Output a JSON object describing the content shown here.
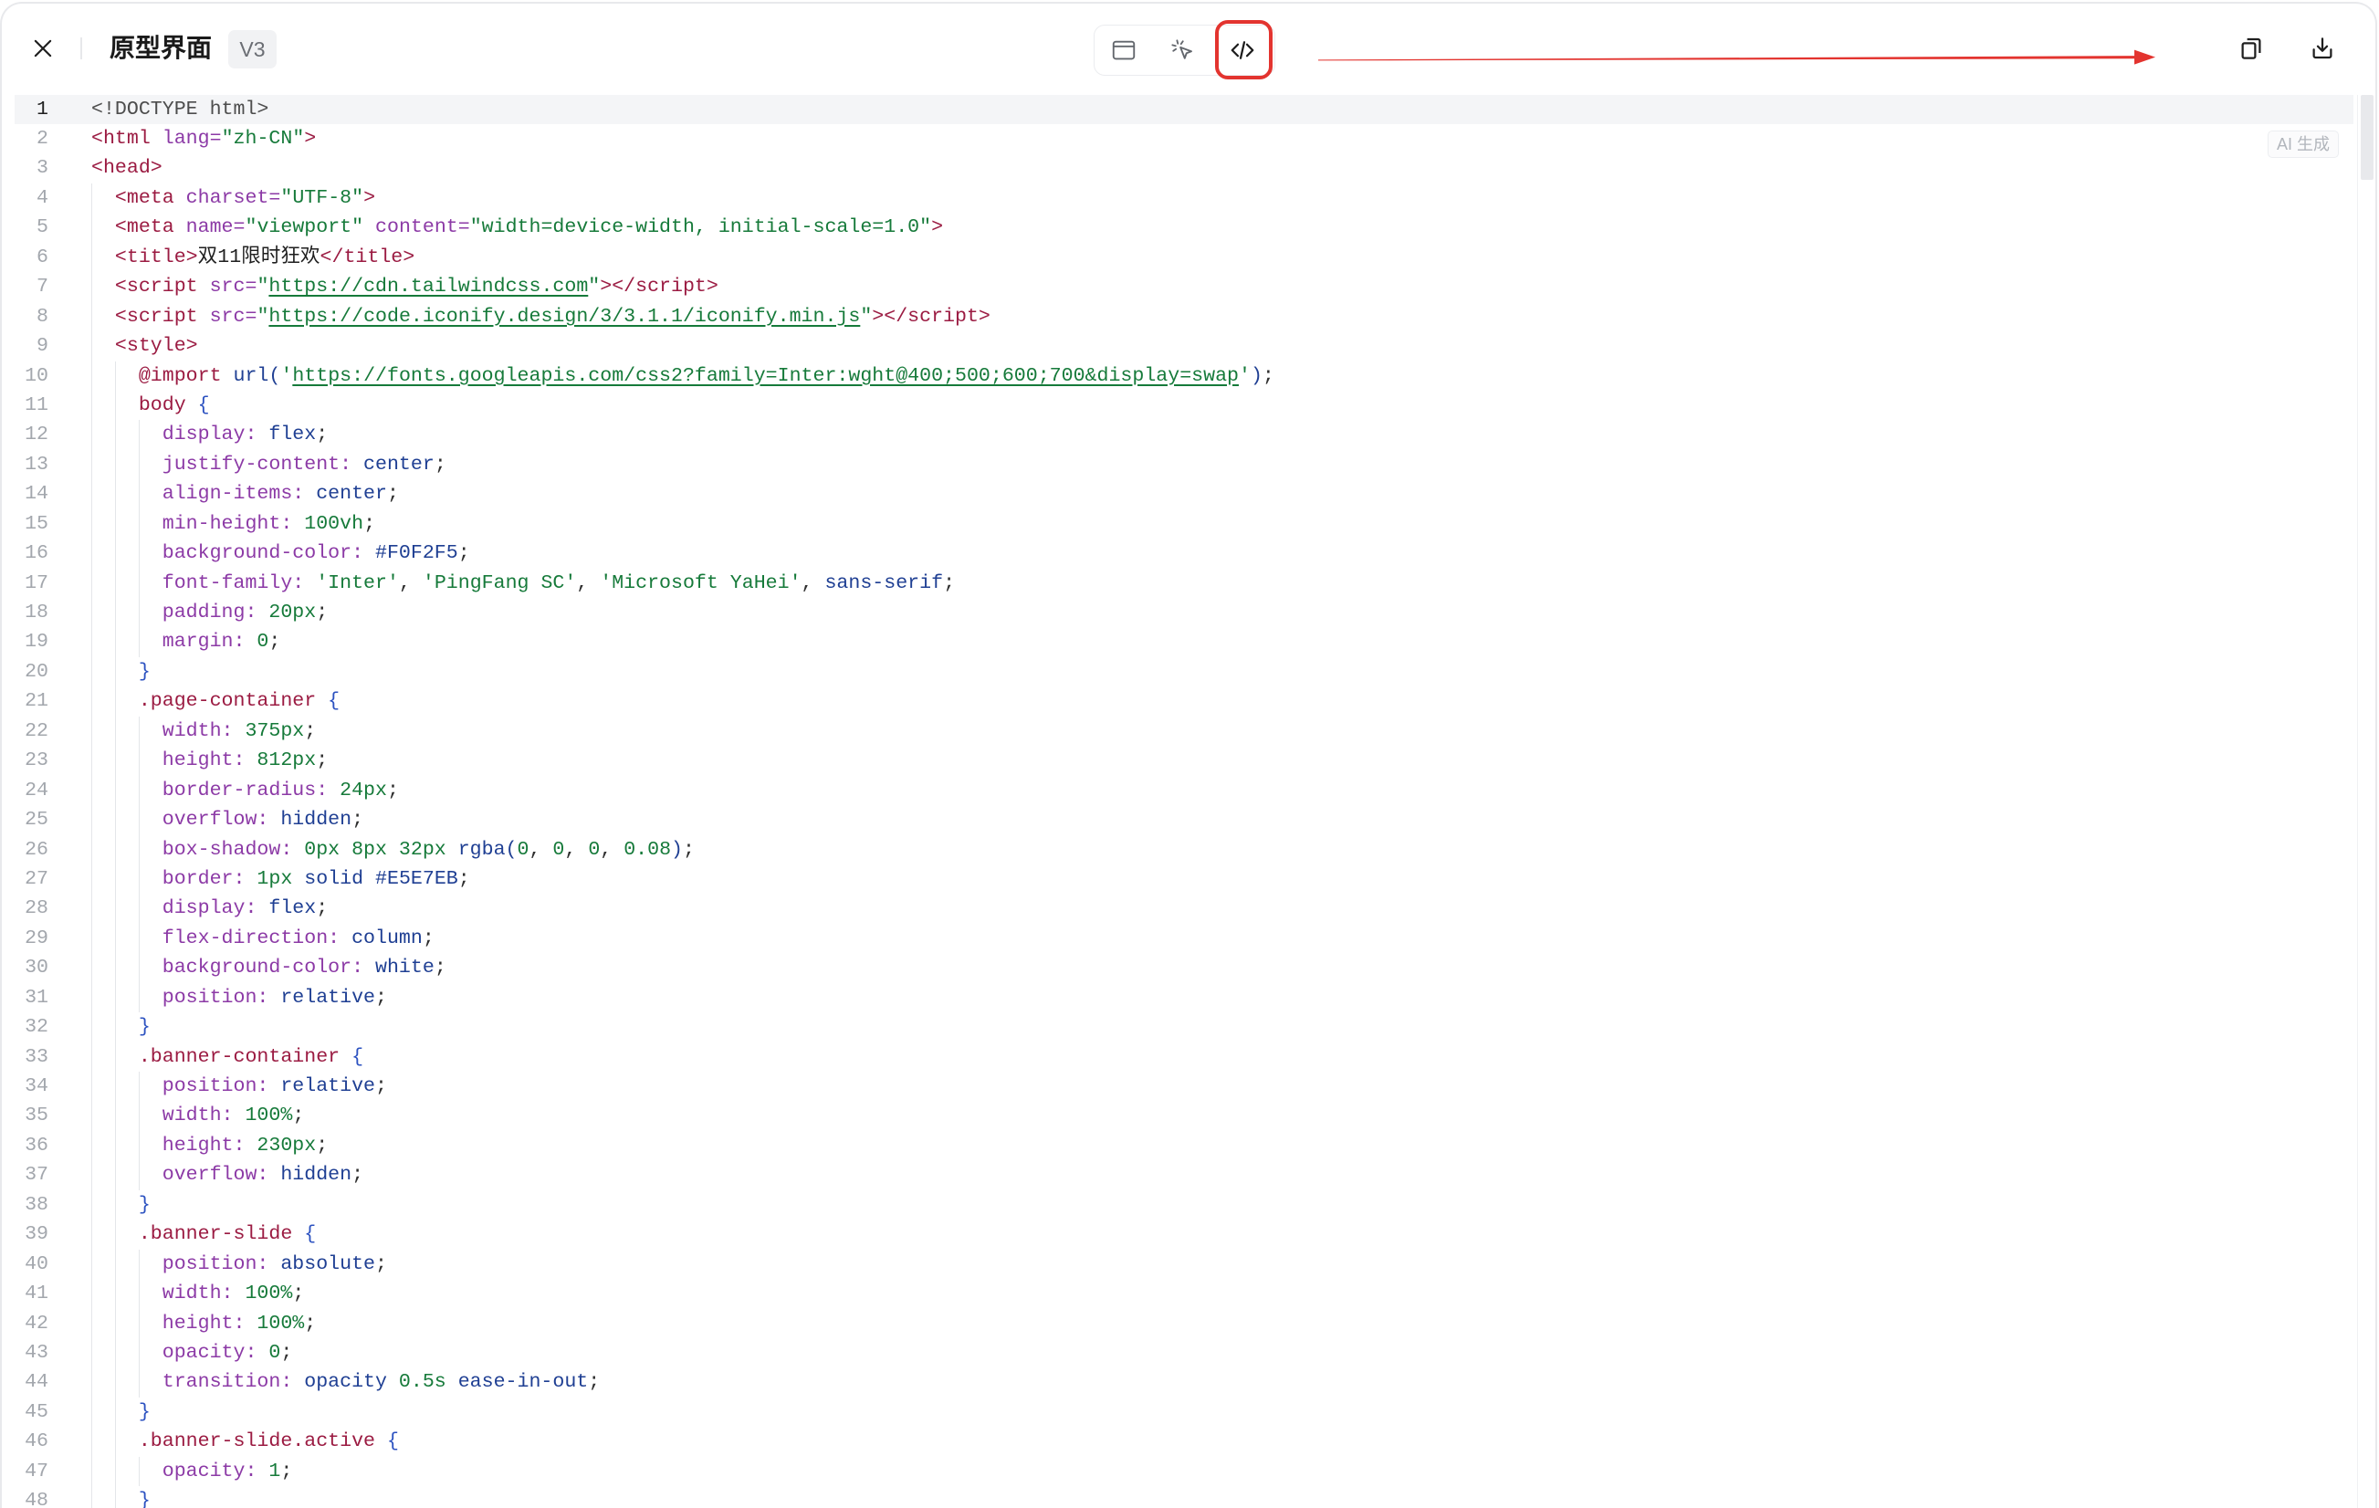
{
  "window": {
    "title": "原型界面",
    "version_badge": "V3"
  },
  "toolbar": {
    "close_icon": "close-icon",
    "view_modes": [
      {
        "icon": "preview-icon",
        "active": false
      },
      {
        "icon": "cursor-click-icon",
        "active": false
      },
      {
        "icon": "code-icon",
        "active": true
      }
    ],
    "actions": [
      {
        "icon": "copy-icon"
      },
      {
        "icon": "download-icon"
      }
    ]
  },
  "colors": {
    "annotation": "#e3342f"
  },
  "editor": {
    "badge": "AI 生成",
    "active_line": 1,
    "lines": [
      {
        "n": "1",
        "t": [
          [
            "<!DOCTYPE html>",
            "#4d4d4d"
          ]
        ]
      },
      {
        "n": "2",
        "t": [
          [
            "<html",
            "#9b1b42"
          ],
          [
            " lang=",
            "#8c3aa6"
          ],
          [
            "\"zh-CN\"",
            "#167a3a"
          ],
          [
            ">",
            "#9b1b42"
          ]
        ]
      },
      {
        "n": "3",
        "t": [
          [
            "<head>",
            "#9b1b42"
          ]
        ]
      },
      {
        "n": "4",
        "t": [
          [
            "  <meta",
            "#9b1b42"
          ],
          [
            " charset=",
            "#8c3aa6"
          ],
          [
            "\"UTF-8\"",
            "#167a3a"
          ],
          [
            ">",
            "#9b1b42"
          ]
        ]
      },
      {
        "n": "5",
        "t": [
          [
            "  <meta",
            "#9b1b42"
          ],
          [
            " name=",
            "#8c3aa6"
          ],
          [
            "\"viewport\"",
            "#167a3a"
          ],
          [
            " content=",
            "#8c3aa6"
          ],
          [
            "\"width=device-width, initial-scale=1.0\"",
            "#167a3a"
          ],
          [
            ">",
            "#9b1b42"
          ]
        ]
      },
      {
        "n": "6",
        "t": [
          [
            "  <title>",
            "#9b1b42"
          ],
          [
            "双11限时狂欢",
            "#1f1f1f"
          ],
          [
            "</title>",
            "#9b1b42"
          ]
        ]
      },
      {
        "n": "7",
        "t": [
          [
            "  <script",
            "#9b1b42"
          ],
          [
            " src=",
            "#8c3aa6"
          ],
          [
            "\"",
            "#167a3a"
          ],
          [
            "https://cdn.tailwindcss.com",
            "#167a3a",
            true
          ],
          [
            "\"",
            "#167a3a"
          ],
          [
            "></script>",
            "#9b1b42"
          ]
        ]
      },
      {
        "n": "8",
        "t": [
          [
            "  <script",
            "#9b1b42"
          ],
          [
            " src=",
            "#8c3aa6"
          ],
          [
            "\"",
            "#167a3a"
          ],
          [
            "https://code.iconify.design/3/3.1.1/iconify.min.js",
            "#167a3a",
            true
          ],
          [
            "\"",
            "#167a3a"
          ],
          [
            "></script>",
            "#9b1b42"
          ]
        ]
      },
      {
        "n": "9",
        "t": [
          [
            "  <style>",
            "#9b1b42"
          ]
        ]
      },
      {
        "n": "10",
        "t": [
          [
            "    @import",
            "#9b1b42"
          ],
          [
            " url(",
            "#1f3f93"
          ],
          [
            "'",
            "#167a3a"
          ],
          [
            "https://fonts.googleapis.com/css2?family=Inter:wght@400;500;600;700&display=swap",
            "#167a3a",
            true
          ],
          [
            "'",
            "#167a3a"
          ],
          [
            ")",
            "#1f3f93"
          ],
          [
            ";",
            "#2f2f2f"
          ]
        ]
      },
      {
        "n": "11",
        "t": [
          [
            "    body",
            "#9b1b42"
          ],
          [
            " {",
            "#2b51c0"
          ]
        ]
      },
      {
        "n": "12",
        "t": [
          [
            "      display:",
            "#8c3aa6"
          ],
          [
            " flex",
            "#1f3f93"
          ],
          [
            ";",
            "#2f2f2f"
          ]
        ]
      },
      {
        "n": "13",
        "t": [
          [
            "      justify-content:",
            "#8c3aa6"
          ],
          [
            " center",
            "#1f3f93"
          ],
          [
            ";",
            "#2f2f2f"
          ]
        ]
      },
      {
        "n": "14",
        "t": [
          [
            "      align-items:",
            "#8c3aa6"
          ],
          [
            " center",
            "#1f3f93"
          ],
          [
            ";",
            "#2f2f2f"
          ]
        ]
      },
      {
        "n": "15",
        "t": [
          [
            "      min-height:",
            "#8c3aa6"
          ],
          [
            " 100vh",
            "#167a3a"
          ],
          [
            ";",
            "#2f2f2f"
          ]
        ]
      },
      {
        "n": "16",
        "t": [
          [
            "      background-color:",
            "#8c3aa6"
          ],
          [
            " #F0F2F5",
            "#1f3f93"
          ],
          [
            ";",
            "#2f2f2f"
          ]
        ]
      },
      {
        "n": "17",
        "t": [
          [
            "      font-family:",
            "#8c3aa6"
          ],
          [
            " 'Inter'",
            "#167a3a"
          ],
          [
            ", ",
            "#2f2f2f"
          ],
          [
            "'PingFang SC'",
            "#167a3a"
          ],
          [
            ", ",
            "#2f2f2f"
          ],
          [
            "'Microsoft YaHei'",
            "#167a3a"
          ],
          [
            ", ",
            "#2f2f2f"
          ],
          [
            "sans-serif",
            "#1f3f93"
          ],
          [
            ";",
            "#2f2f2f"
          ]
        ]
      },
      {
        "n": "18",
        "t": [
          [
            "      padding:",
            "#8c3aa6"
          ],
          [
            " 20px",
            "#167a3a"
          ],
          [
            ";",
            "#2f2f2f"
          ]
        ]
      },
      {
        "n": "19",
        "t": [
          [
            "      margin:",
            "#8c3aa6"
          ],
          [
            " 0",
            "#167a3a"
          ],
          [
            ";",
            "#2f2f2f"
          ]
        ]
      },
      {
        "n": "20",
        "t": [
          [
            "    }",
            "#2b51c0"
          ]
        ]
      },
      {
        "n": "21",
        "t": [
          [
            "    .page-container",
            "#9b1b42"
          ],
          [
            " {",
            "#2b51c0"
          ]
        ]
      },
      {
        "n": "22",
        "t": [
          [
            "      width:",
            "#8c3aa6"
          ],
          [
            " 375px",
            "#167a3a"
          ],
          [
            ";",
            "#2f2f2f"
          ]
        ]
      },
      {
        "n": "23",
        "t": [
          [
            "      height:",
            "#8c3aa6"
          ],
          [
            " 812px",
            "#167a3a"
          ],
          [
            ";",
            "#2f2f2f"
          ]
        ]
      },
      {
        "n": "24",
        "t": [
          [
            "      border-radius:",
            "#8c3aa6"
          ],
          [
            " 24px",
            "#167a3a"
          ],
          [
            ";",
            "#2f2f2f"
          ]
        ]
      },
      {
        "n": "25",
        "t": [
          [
            "      overflow:",
            "#8c3aa6"
          ],
          [
            " hidden",
            "#1f3f93"
          ],
          [
            ";",
            "#2f2f2f"
          ]
        ]
      },
      {
        "n": "26",
        "t": [
          [
            "      box-shadow:",
            "#8c3aa6"
          ],
          [
            " 0px 8px 32px",
            "#167a3a"
          ],
          [
            " rgba(",
            "#1f3f93"
          ],
          [
            "0",
            "#167a3a"
          ],
          [
            ", ",
            "#2f2f2f"
          ],
          [
            "0",
            "#167a3a"
          ],
          [
            ", ",
            "#2f2f2f"
          ],
          [
            "0",
            "#167a3a"
          ],
          [
            ", ",
            "#2f2f2f"
          ],
          [
            "0.08",
            "#167a3a"
          ],
          [
            ")",
            "#1f3f93"
          ],
          [
            ";",
            "#2f2f2f"
          ]
        ]
      },
      {
        "n": "27",
        "t": [
          [
            "      border:",
            "#8c3aa6"
          ],
          [
            " 1px",
            "#167a3a"
          ],
          [
            " solid",
            "#1f3f93"
          ],
          [
            " #E5E7EB",
            "#1f3f93"
          ],
          [
            ";",
            "#2f2f2f"
          ]
        ]
      },
      {
        "n": "28",
        "t": [
          [
            "      display:",
            "#8c3aa6"
          ],
          [
            " flex",
            "#1f3f93"
          ],
          [
            ";",
            "#2f2f2f"
          ]
        ]
      },
      {
        "n": "29",
        "t": [
          [
            "      flex-direction:",
            "#8c3aa6"
          ],
          [
            " column",
            "#1f3f93"
          ],
          [
            ";",
            "#2f2f2f"
          ]
        ]
      },
      {
        "n": "30",
        "t": [
          [
            "      background-color:",
            "#8c3aa6"
          ],
          [
            " white",
            "#1f3f93"
          ],
          [
            ";",
            "#2f2f2f"
          ]
        ]
      },
      {
        "n": "31",
        "t": [
          [
            "      position:",
            "#8c3aa6"
          ],
          [
            " relative",
            "#1f3f93"
          ],
          [
            ";",
            "#2f2f2f"
          ]
        ]
      },
      {
        "n": "32",
        "t": [
          [
            "    }",
            "#2b51c0"
          ]
        ]
      },
      {
        "n": "33",
        "t": [
          [
            "    .banner-container",
            "#9b1b42"
          ],
          [
            " {",
            "#2b51c0"
          ]
        ]
      },
      {
        "n": "34",
        "t": [
          [
            "      position:",
            "#8c3aa6"
          ],
          [
            " relative",
            "#1f3f93"
          ],
          [
            ";",
            "#2f2f2f"
          ]
        ]
      },
      {
        "n": "35",
        "t": [
          [
            "      width:",
            "#8c3aa6"
          ],
          [
            " 100%",
            "#167a3a"
          ],
          [
            ";",
            "#2f2f2f"
          ]
        ]
      },
      {
        "n": "36",
        "t": [
          [
            "      height:",
            "#8c3aa6"
          ],
          [
            " 230px",
            "#167a3a"
          ],
          [
            ";",
            "#2f2f2f"
          ]
        ]
      },
      {
        "n": "37",
        "t": [
          [
            "      overflow:",
            "#8c3aa6"
          ],
          [
            " hidden",
            "#1f3f93"
          ],
          [
            ";",
            "#2f2f2f"
          ]
        ]
      },
      {
        "n": "38",
        "t": [
          [
            "    }",
            "#2b51c0"
          ]
        ]
      },
      {
        "n": "39",
        "t": [
          [
            "    .banner-slide",
            "#9b1b42"
          ],
          [
            " {",
            "#2b51c0"
          ]
        ]
      },
      {
        "n": "40",
        "t": [
          [
            "      position:",
            "#8c3aa6"
          ],
          [
            " absolute",
            "#1f3f93"
          ],
          [
            ";",
            "#2f2f2f"
          ]
        ]
      },
      {
        "n": "41",
        "t": [
          [
            "      width:",
            "#8c3aa6"
          ],
          [
            " 100%",
            "#167a3a"
          ],
          [
            ";",
            "#2f2f2f"
          ]
        ]
      },
      {
        "n": "42",
        "t": [
          [
            "      height:",
            "#8c3aa6"
          ],
          [
            " 100%",
            "#167a3a"
          ],
          [
            ";",
            "#2f2f2f"
          ]
        ]
      },
      {
        "n": "43",
        "t": [
          [
            "      opacity:",
            "#8c3aa6"
          ],
          [
            " 0",
            "#167a3a"
          ],
          [
            ";",
            "#2f2f2f"
          ]
        ]
      },
      {
        "n": "44",
        "t": [
          [
            "      transition:",
            "#8c3aa6"
          ],
          [
            " opacity",
            "#1f3f93"
          ],
          [
            " 0.5s",
            "#167a3a"
          ],
          [
            " ease-in-out",
            "#1f3f93"
          ],
          [
            ";",
            "#2f2f2f"
          ]
        ]
      },
      {
        "n": "45",
        "t": [
          [
            "    }",
            "#2b51c0"
          ]
        ]
      },
      {
        "n": "46",
        "t": [
          [
            "    .banner-slide.active",
            "#9b1b42"
          ],
          [
            " {",
            "#2b51c0"
          ]
        ]
      },
      {
        "n": "47",
        "t": [
          [
            "      opacity:",
            "#8c3aa6"
          ],
          [
            " 1",
            "#167a3a"
          ],
          [
            ";",
            "#2f2f2f"
          ]
        ]
      },
      {
        "n": "48",
        "t": [
          [
            "    }",
            "#2b51c0"
          ]
        ]
      }
    ]
  }
}
